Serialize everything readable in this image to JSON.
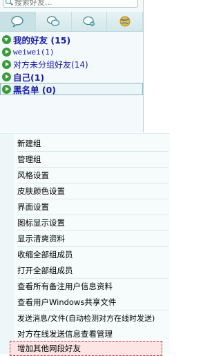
{
  "search": {
    "placeholder": "搜索好友..."
  },
  "tabs": [
    {
      "icon": "chat-bubble-icon",
      "active": true
    },
    {
      "icon": "speech-bubbles-icon",
      "active": false
    },
    {
      "icon": "group-chat-icon",
      "active": false
    },
    {
      "icon": "globe-icon",
      "active": false
    }
  ],
  "tree": [
    {
      "label": "我的好友",
      "count": "(15)",
      "expanded": true
    },
    {
      "label": "weiwei",
      "count": "(1)",
      "expanded": false
    },
    {
      "label": "对方未分组好友",
      "count": "(14)",
      "expanded": false
    },
    {
      "label": "自己",
      "count": "(1)",
      "expanded": false
    },
    {
      "label": "黑名单",
      "count": "(0)",
      "expanded": false
    }
  ],
  "menu": {
    "items": [
      "新建组",
      "管理组",
      "风格设置",
      "皮肤颜色设置",
      "界面设置",
      "图标显示设置",
      "显示清爽资料",
      "收缩全部组成员",
      "打开全部组成员",
      "查看所有备注用户信息资料",
      "查看用户Windows共享文件",
      "发送消息/文件(自动检测对方在线时发送)",
      "对方在线发送信息查看管理",
      "增加其他网段好友"
    ]
  },
  "colors": {
    "accent": "#3b9b3c",
    "group_text": "#1a1aa8",
    "highlight_border": "#d02a2a"
  }
}
